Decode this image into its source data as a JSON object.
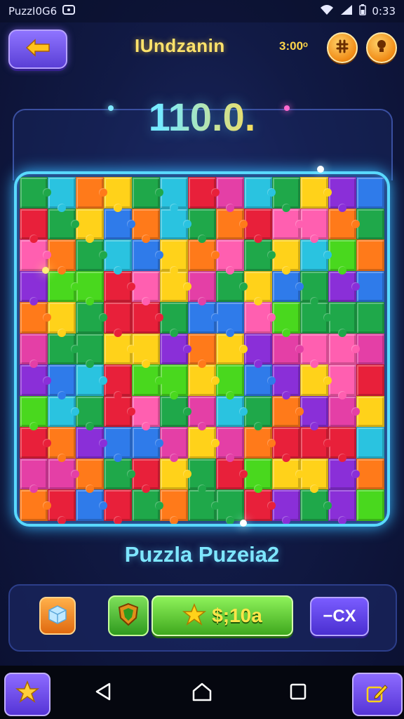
{
  "status_bar": {
    "left_text": "PuzzI0G6",
    "time": "0:33"
  },
  "header": {
    "title": "IUndzanin",
    "coins": "3:00ᵒ"
  },
  "score": "110.0.",
  "puzzle_name": "Puzzla Puzeia2",
  "bottom_bar": {
    "price": "$;10a",
    "cx_label": "−CX"
  },
  "board": {
    "colors": [
      "#e8203a",
      "#ff7a1a",
      "#ffd21a",
      "#49d81e",
      "#1fa84a",
      "#2ac3e0",
      "#2f7bea",
      "#8a2fd8",
      "#e43fa6",
      "#ff5fb0"
    ]
  },
  "accent": {
    "cyan": "#59d9ff",
    "gold": "#ffd54a",
    "purple": "#6a4ef0"
  }
}
